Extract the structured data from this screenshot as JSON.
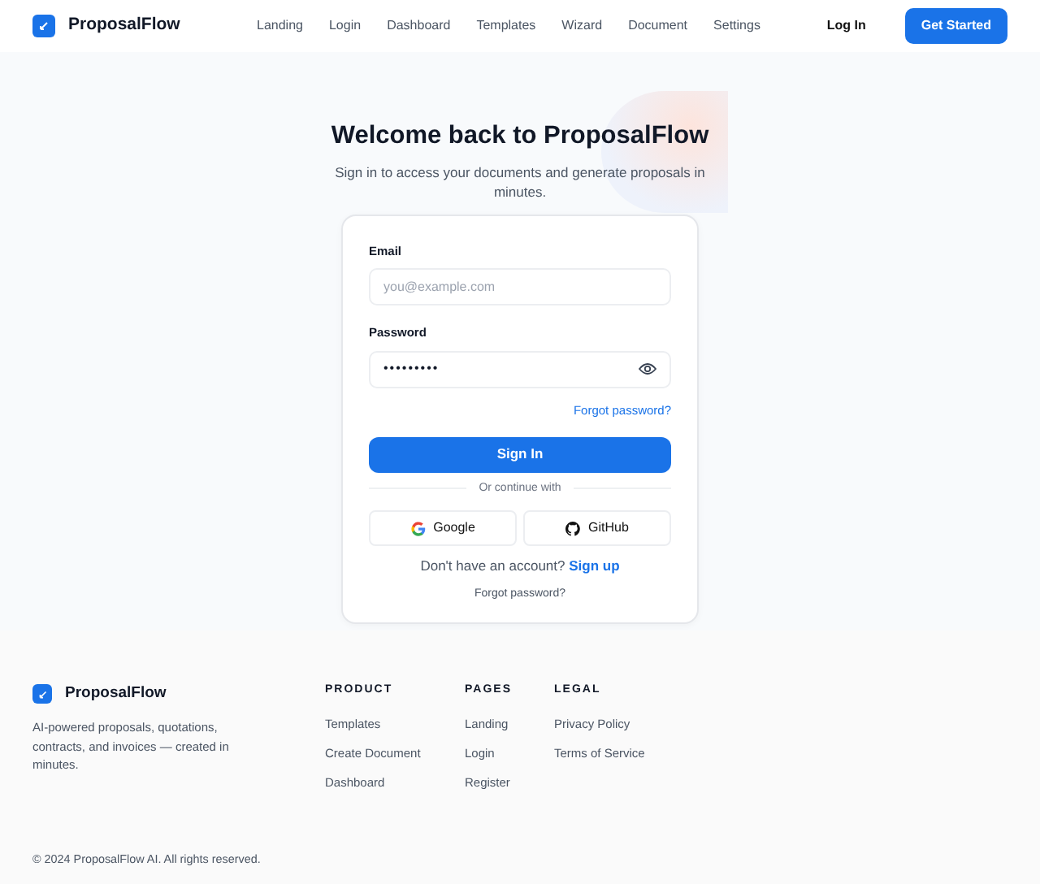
{
  "brand": "ProposalFlow",
  "nav": [
    "Landing",
    "Login",
    "Dashboard",
    "Templates",
    "Wizard",
    "Document",
    "Settings"
  ],
  "nav_actions": {
    "login": "Log In",
    "cta": "Get Started"
  },
  "hero": {
    "title": "Welcome back to ProposalFlow",
    "subtitle": "Sign in to access your documents and generate proposals in minutes."
  },
  "form": {
    "email_label": "Email",
    "email_placeholder": "you@example.com",
    "password_label": "Password",
    "password_value": "•••••••••",
    "forgot_link": "Forgot password?",
    "submit": "Sign In",
    "divider": "Or continue with",
    "social": [
      {
        "kind": "google",
        "label": "Google"
      },
      {
        "kind": "github",
        "label": "GitHub"
      }
    ],
    "signup_text": "Don't have an account?",
    "signup_link": "Sign up",
    "forgot_bottom": "Forgot password?"
  },
  "footer": {
    "brand": "ProposalFlow",
    "tagline": "AI-powered proposals, quotations, contracts, and invoices — created in minutes.",
    "columns": [
      {
        "heading": "PRODUCT",
        "links": [
          "Templates",
          "Create Document",
          "Dashboard"
        ]
      },
      {
        "heading": "PAGES",
        "links": [
          "Landing",
          "Login",
          "Register"
        ]
      },
      {
        "heading": "LEGAL",
        "links": [
          "Privacy Policy",
          "Terms of Service"
        ]
      }
    ],
    "copyright": "© 2024 ProposalFlow AI. All rights reserved."
  }
}
